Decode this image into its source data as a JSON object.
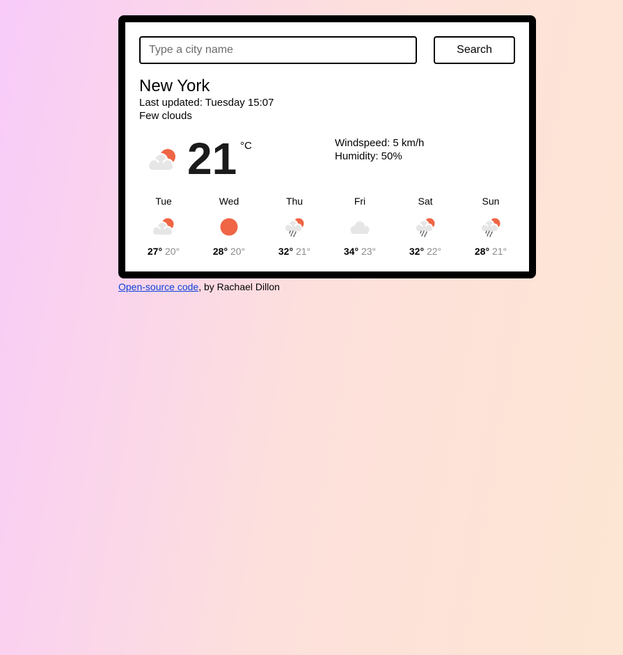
{
  "search": {
    "placeholder": "Type a city name",
    "button_label": "Search"
  },
  "current": {
    "city": "New York",
    "last_updated": "Last updated: Tuesday 15:07",
    "description": "Few clouds",
    "temperature": "21",
    "unit": "°C",
    "windspeed": "Windspeed: 5 km/h",
    "humidity": "Humidity: 50%",
    "icon": "few-clouds-icon"
  },
  "forecast": [
    {
      "day": "Tue",
      "max": "27°",
      "min": "20°",
      "icon": "few-clouds-icon"
    },
    {
      "day": "Wed",
      "max": "28°",
      "min": "20°",
      "icon": "sun-icon"
    },
    {
      "day": "Thu",
      "max": "32°",
      "min": "21°",
      "icon": "rain-icon"
    },
    {
      "day": "Fri",
      "max": "34°",
      "min": "23°",
      "icon": "cloud-icon"
    },
    {
      "day": "Sat",
      "max": "32°",
      "min": "22°",
      "icon": "rain-icon"
    },
    {
      "day": "Sun",
      "max": "28°",
      "min": "21°",
      "icon": "rain-icon"
    }
  ],
  "footer": {
    "link_text": "Open-source code",
    "suffix": ", by Rachael Dillon"
  },
  "colors": {
    "sun": "#ef6545",
    "cloud": "#e6e6e6",
    "rain": "#555555",
    "link": "#0b3fd9"
  }
}
